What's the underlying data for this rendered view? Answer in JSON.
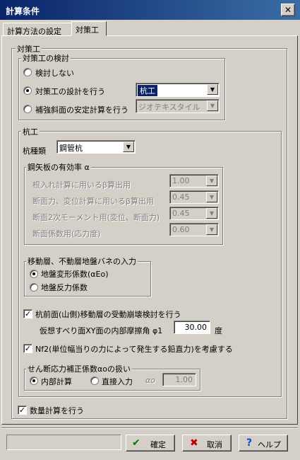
{
  "window": {
    "title": "計算条件",
    "close_glyph": "✕"
  },
  "tabs": [
    {
      "label": "計算方法の設定"
    },
    {
      "label": "対策工"
    }
  ],
  "section": {
    "label": "対策工"
  },
  "measure_review": {
    "legend": "対策工の検討",
    "options": [
      {
        "label": "検討しない",
        "selected": false
      },
      {
        "label": "対策工の設計を行う",
        "selected": true
      },
      {
        "label": "補強斜面の安定計算を行う",
        "selected": false
      }
    ],
    "design_combo": {
      "value": "杭工"
    },
    "reinforce_combo": {
      "value": "ジオテキスタイル"
    }
  },
  "pile": {
    "legend": "杭工",
    "type_label": "杭種類",
    "type_combo": {
      "value": "鋼管杭"
    },
    "sheet_pile": {
      "legend": "鋼矢板の有効率 α",
      "rows": [
        {
          "label": "根入れ計算に用いるβ算出用",
          "value": "1.00"
        },
        {
          "label": "断面力、変位計算に用いるβ算出用",
          "value": "0.45"
        },
        {
          "label": "断面2次モーメント用(変位、断面力)",
          "value": "0.45"
        },
        {
          "label": "断面係数用(応力度)",
          "value": "0.60"
        }
      ]
    },
    "spring": {
      "legend": "移動層、不動層地盤バネの入力",
      "options": [
        {
          "label": "地盤変形係数(αEo)",
          "selected": true
        },
        {
          "label": "地盤反力係数",
          "selected": false
        }
      ]
    },
    "passive_check": {
      "label": "杭前面(山側)移動層の受動崩壊検討を行う",
      "checked": true
    },
    "friction": {
      "label": "仮想すべり面XY面の内部摩擦角 φ1",
      "value": "30.00",
      "unit": "度"
    },
    "nf2_check": {
      "label": "Nf2(単位幅当りの力によって発生する鉛直力)を考慮する",
      "checked": true
    },
    "shear": {
      "legend": "せん断応力補正係数αoの扱い",
      "options": [
        {
          "label": "内部計算",
          "selected": true
        },
        {
          "label": "直接入力",
          "selected": false
        }
      ],
      "alpha_label": "αo",
      "alpha_value": "1.00"
    }
  },
  "quantity_check": {
    "label": "数量計算を行う",
    "checked": true
  },
  "buttons": {
    "ok": {
      "label": "確定",
      "icon": "✔"
    },
    "cancel": {
      "label": "取消",
      "icon": "✖"
    },
    "help": {
      "label": "ヘルプ",
      "icon": "?"
    }
  },
  "colors": {
    "titlebar_start": "#0a246a",
    "titlebar_end": "#3a6ea5",
    "dialog_face": "#d4d0c8",
    "ok_icon": "#007a00",
    "cancel_icon": "#c00000",
    "help_icon": "#0050c8"
  }
}
